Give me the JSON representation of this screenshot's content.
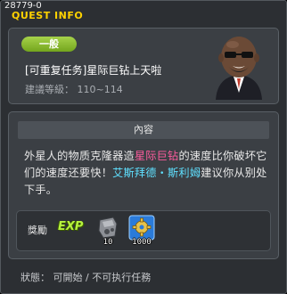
{
  "window": {
    "id_label": "28779-0",
    "title": "QUEST INFO"
  },
  "quest": {
    "category": "一般",
    "name": "[可重复任务]星际巨钻上天啦",
    "level_label": "建議等級：",
    "level_range": "110~114"
  },
  "content": {
    "header": "內容",
    "text_1": "外星人的物质克隆器造",
    "highlight_item": "星际巨钻",
    "text_2": "的速度比你破坏它们的速度还要快！",
    "highlight_npc": "艾斯拜德・斯利姆",
    "text_3": "建议你从别处下手。"
  },
  "rewards": {
    "label": "獎勵",
    "exp_label": "EXP",
    "items": [
      {
        "icon": "machine-part-icon",
        "count": "10"
      },
      {
        "icon": "gear-icon",
        "count": "1000"
      }
    ]
  },
  "status": {
    "label": "狀態：",
    "value": "可開始 / 不可执行任務"
  },
  "colors": {
    "title": "#ffd200",
    "highlight_item": "#ff5c9e",
    "highlight_npc": "#5fe0ff",
    "badge": "#8cbf2d"
  }
}
